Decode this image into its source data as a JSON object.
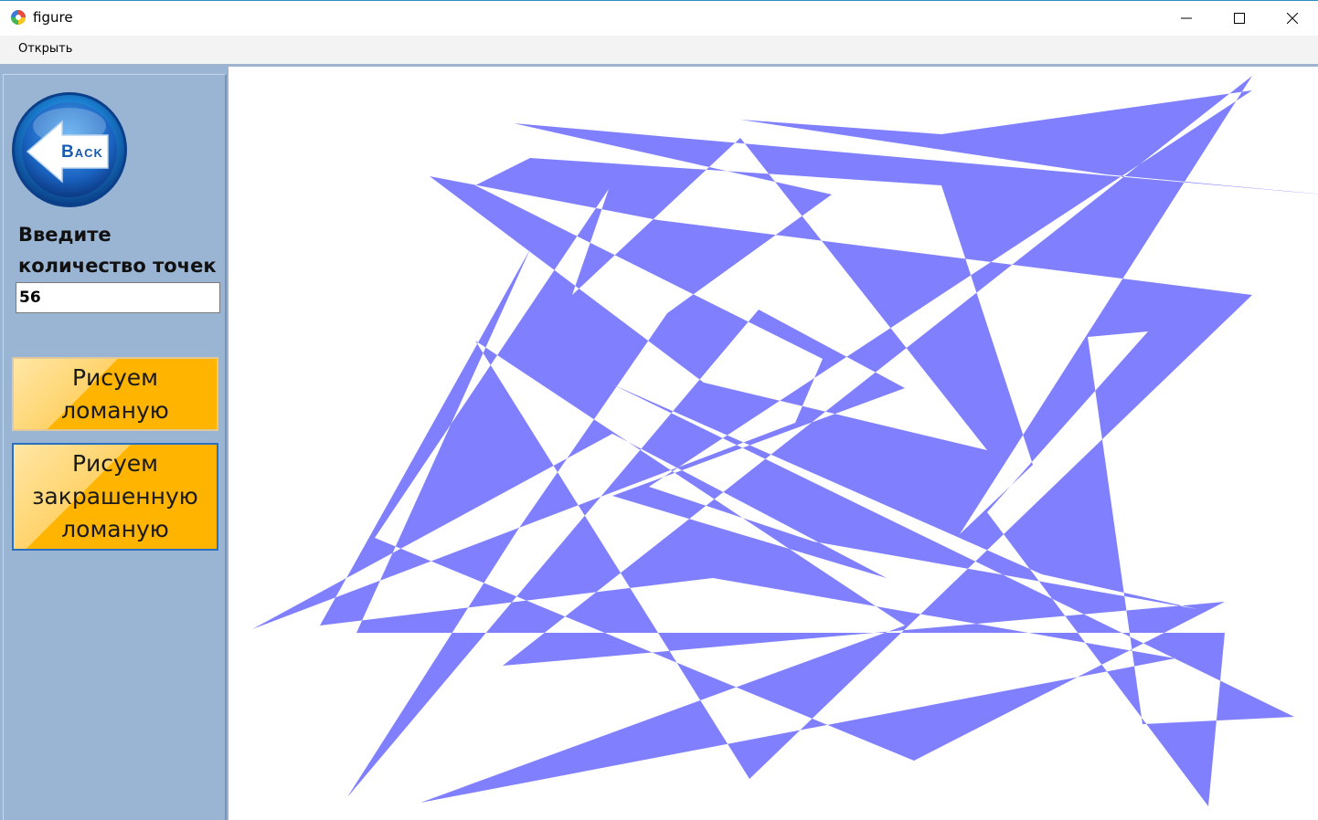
{
  "window": {
    "title": "figure"
  },
  "menu": {
    "items": [
      "Открыть"
    ]
  },
  "back_button": {
    "label": "Back"
  },
  "input": {
    "label_line1": "Введите",
    "label_line2": "количество точек",
    "value": "56"
  },
  "buttons": {
    "draw_polyline_line1": "Рисуем",
    "draw_polyline_line2": "ломаную",
    "draw_filled_line1": "Рисуем",
    "draw_filled_line2": "закрашенную",
    "draw_filled_line3": "ломаную"
  },
  "colors": {
    "fill": "#8080ff",
    "panel": "#9ab4d4",
    "button": "#ffb400",
    "canvas": "#ffffff"
  },
  "icons": [
    "app-icon",
    "minimize-icon",
    "maximize-icon",
    "close-icon",
    "back-arrow-icon"
  ]
}
